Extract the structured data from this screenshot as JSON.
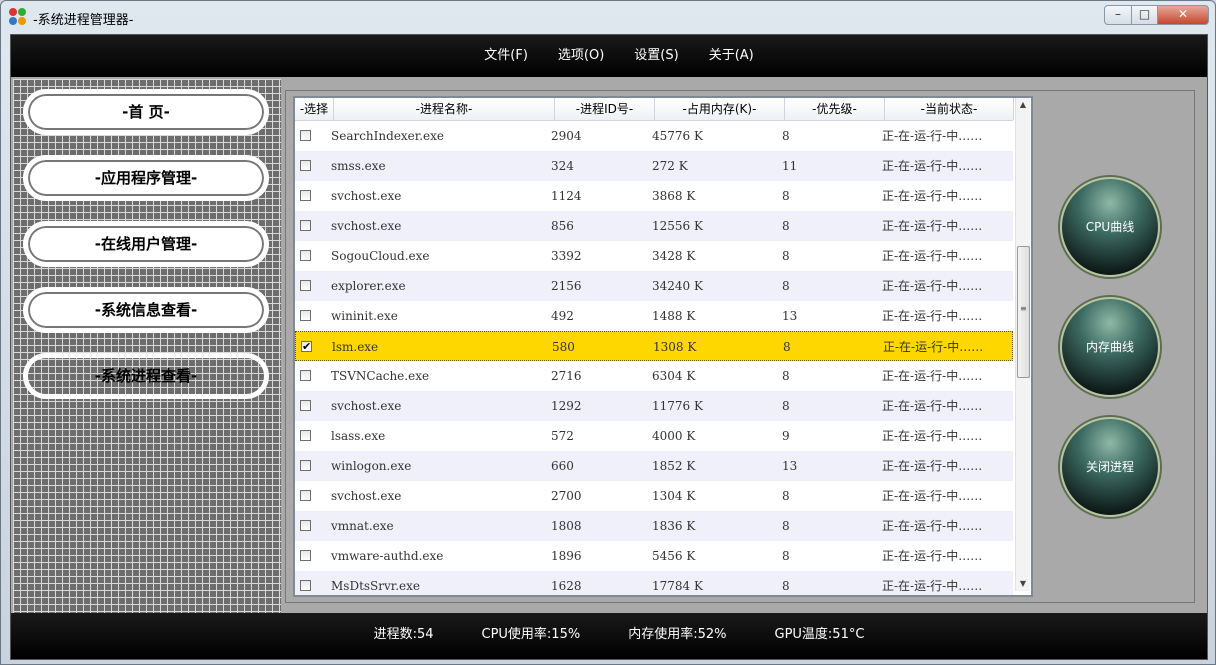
{
  "window": {
    "title": "-系统进程管理器-"
  },
  "menu": [
    "文件(F)",
    "选项(O)",
    "设置(S)",
    "关于(A)"
  ],
  "sidebar": [
    {
      "label": "-首 页-"
    },
    {
      "label": "-应用程序管理-"
    },
    {
      "label": "-在线用户管理-"
    },
    {
      "label": "-系统信息查看-"
    },
    {
      "label": "-系统进程查看-"
    }
  ],
  "table": {
    "columns": [
      "-选择",
      "-进程名称-",
      "-进程ID号-",
      "-占用内存(K)-",
      "-优先级-",
      "-当前状态-"
    ],
    "rows": [
      {
        "name": "SearchIndexer.exe",
        "pid": "2904",
        "mem": "45776 K",
        "priority": "8",
        "status": "正-在-运-行-中……",
        "checked": false
      },
      {
        "name": "smss.exe",
        "pid": "324",
        "mem": "272 K",
        "priority": "11",
        "status": "正-在-运-行-中……",
        "checked": false
      },
      {
        "name": "svchost.exe",
        "pid": "1124",
        "mem": "3868 K",
        "priority": "8",
        "status": "正-在-运-行-中……",
        "checked": false
      },
      {
        "name": "svchost.exe",
        "pid": "856",
        "mem": "12556 K",
        "priority": "8",
        "status": "正-在-运-行-中……",
        "checked": false
      },
      {
        "name": "SogouCloud.exe",
        "pid": "3392",
        "mem": "3428 K",
        "priority": "8",
        "status": "正-在-运-行-中……",
        "checked": false
      },
      {
        "name": "explorer.exe",
        "pid": "2156",
        "mem": "34240 K",
        "priority": "8",
        "status": "正-在-运-行-中……",
        "checked": false
      },
      {
        "name": "wininit.exe",
        "pid": "492",
        "mem": "1488 K",
        "priority": "13",
        "status": "正-在-运-行-中……",
        "checked": false
      },
      {
        "name": "lsm.exe",
        "pid": "580",
        "mem": "1308 K",
        "priority": "8",
        "status": "正-在-运-行-中……",
        "checked": true
      },
      {
        "name": "TSVNCache.exe",
        "pid": "2716",
        "mem": "6304 K",
        "priority": "8",
        "status": "正-在-运-行-中……",
        "checked": false
      },
      {
        "name": "svchost.exe",
        "pid": "1292",
        "mem": "11776 K",
        "priority": "8",
        "status": "正-在-运-行-中……",
        "checked": false
      },
      {
        "name": "lsass.exe",
        "pid": "572",
        "mem": "4000 K",
        "priority": "9",
        "status": "正-在-运-行-中……",
        "checked": false
      },
      {
        "name": "winlogon.exe",
        "pid": "660",
        "mem": "1852 K",
        "priority": "13",
        "status": "正-在-运-行-中……",
        "checked": false
      },
      {
        "name": "svchost.exe",
        "pid": "2700",
        "mem": "1304 K",
        "priority": "8",
        "status": "正-在-运-行-中……",
        "checked": false
      },
      {
        "name": "vmnat.exe",
        "pid": "1808",
        "mem": "1836 K",
        "priority": "8",
        "status": "正-在-运-行-中……",
        "checked": false
      },
      {
        "name": "vmware-authd.exe",
        "pid": "1896",
        "mem": "5456 K",
        "priority": "8",
        "status": "正-在-运-行-中……",
        "checked": false
      },
      {
        "name": "MsDtsSrvr.exe",
        "pid": "1628",
        "mem": "17784 K",
        "priority": "8",
        "status": "正-在-运-行-中……",
        "checked": false
      }
    ]
  },
  "actions": {
    "cpu": "CPU曲线",
    "mem": "内存曲线",
    "kill": "关闭进程"
  },
  "status": {
    "process_count": "进程数:54",
    "cpu_usage": "CPU使用率:15%",
    "mem_usage": "内存使用率:52%",
    "gpu_temp": "GPU温度:51°C"
  },
  "colors": {
    "selected_row": "#ffd700",
    "alt_row": "#f0f0fa",
    "bar": "#000000"
  }
}
